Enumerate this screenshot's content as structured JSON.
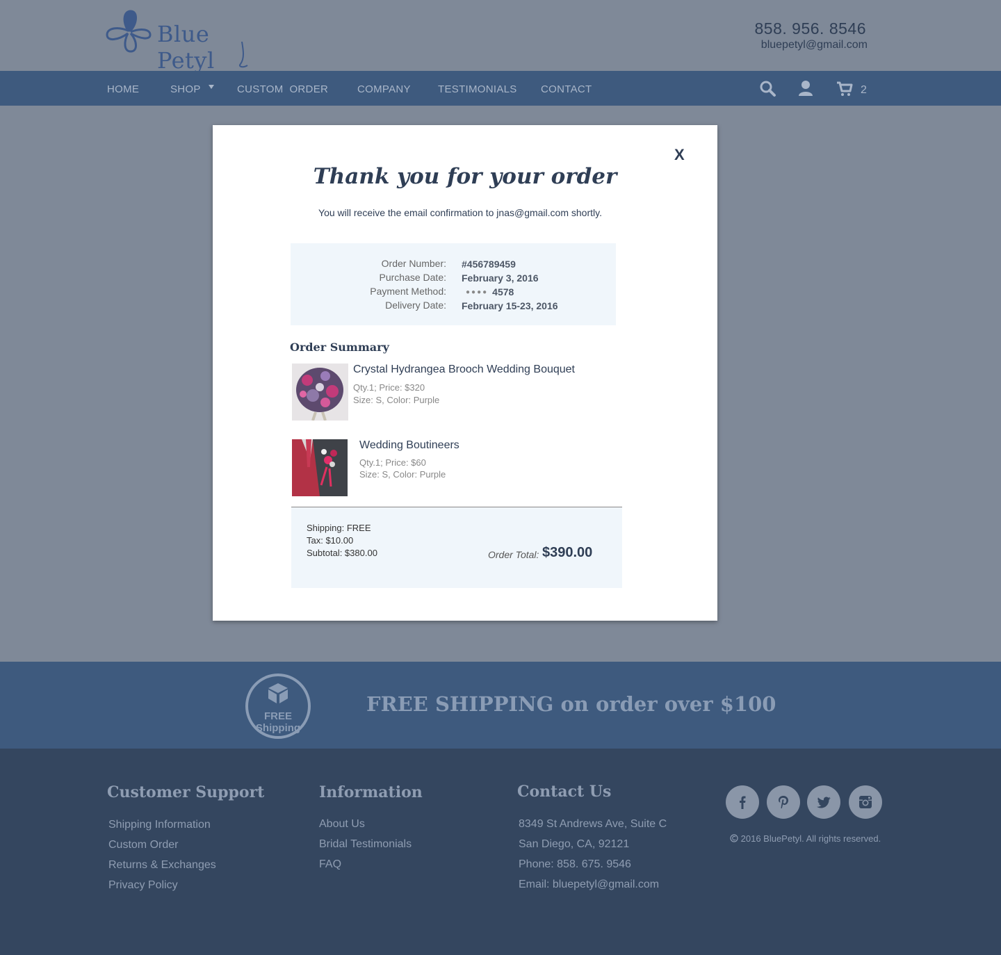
{
  "header": {
    "brand": "Blue Petyl",
    "phone": "858. 956. 8546",
    "email": "bluepetyl@gmail.com"
  },
  "nav": {
    "items": [
      "HOME",
      "SHOP",
      "CUSTOM  ORDER",
      "COMPANY",
      "TESTIMONIALS",
      "CONTACT"
    ],
    "cart_count": "2"
  },
  "modal": {
    "close_label": "X",
    "title": "Thank you for your order",
    "subtitle": "You will receive the email confirmation to jnas@gmail.com shortly.",
    "order_number_label": "Order Number:",
    "order_number": "#456789459",
    "purchase_date_label": "Purchase Date:",
    "purchase_date": "February 3, 2016",
    "payment_method_label": "Payment Method:",
    "payment_dots": "●●●●",
    "payment_last4": "4578",
    "delivery_date_label": "Delivery Date:",
    "delivery_date": "February 15-23, 2016",
    "summary_title": "Order Summary",
    "products": [
      {
        "name": "Crystal Hydrangea Brooch Wedding Bouquet",
        "qty_price": "Qty.1; Price: $320",
        "size_color": "Size: S, Color: Purple"
      },
      {
        "name": "Wedding Boutineers",
        "qty_price": "Qty.1; Price: $60",
        "size_color": "Size: S, Color: Purple"
      }
    ],
    "shipping": "Shipping: FREE",
    "tax": "Tax: $10.00",
    "subtotal": "Subtotal: $380.00",
    "order_total_label": "Order Total:",
    "order_total": "$390.00"
  },
  "shipping_band": {
    "icon_text_1": "FREE",
    "icon_text_2": "Shipping",
    "text": "FREE SHIPPING on order over $100"
  },
  "footer": {
    "customer_support": {
      "title": "Customer Support",
      "links": [
        "Shipping Information",
        "Custom Order",
        "Returns & Exchanges",
        "Privacy Policy"
      ]
    },
    "information": {
      "title": "Information",
      "links": [
        "About Us",
        "Bridal Testimonials",
        "FAQ"
      ]
    },
    "contact": {
      "title": "Contact Us",
      "lines": [
        "8349 St Andrews Ave, Suite C",
        "San Diego, CA, 92121",
        "Phone: 858. 675. 9546",
        "Email: bluepetyl@gmail.com"
      ]
    },
    "social_icons": [
      "facebook-icon",
      "pinterest-icon",
      "twitter-icon",
      "instagram-icon"
    ],
    "copyright": "2016 BluePetyl. All rights reserved."
  },
  "colors": {
    "header_bg": "#7f8998",
    "nav_bg": "#3e5a7e",
    "footer_bg": "#34465f",
    "accent": "#2f3e55",
    "panel_bg": "#f0f6fb"
  }
}
